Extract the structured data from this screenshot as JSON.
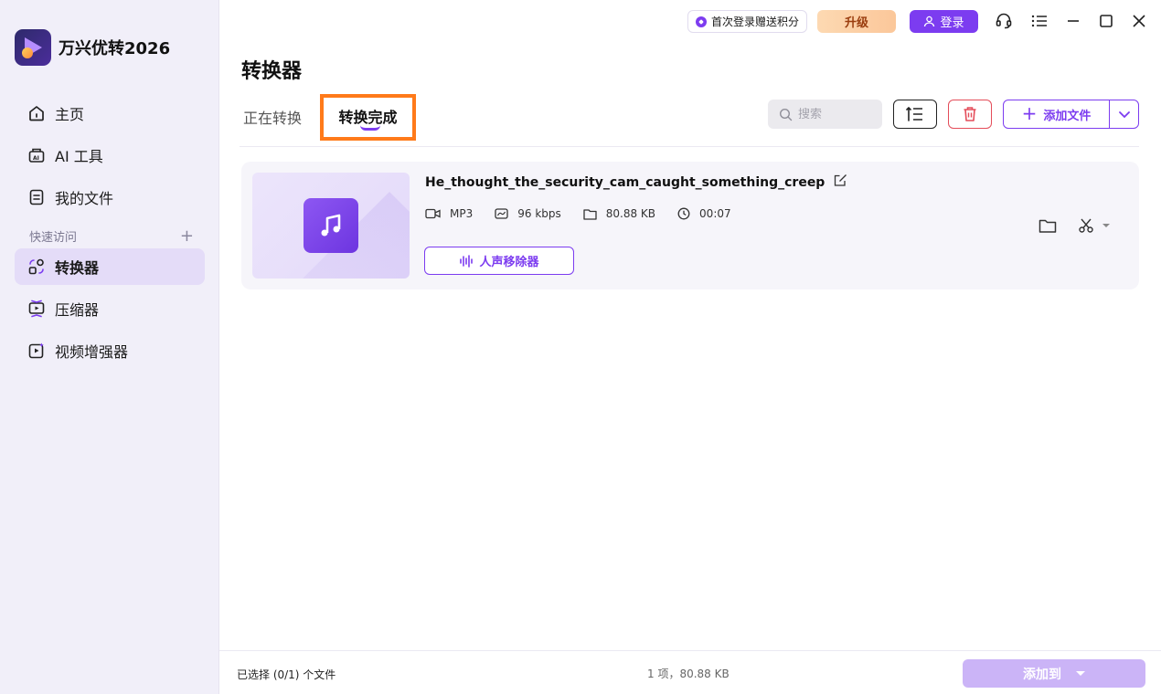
{
  "app": {
    "name": "万兴优转2026"
  },
  "sidebar": {
    "items": [
      {
        "label": "主页",
        "icon": "home-icon"
      },
      {
        "label": "AI 工具",
        "icon": "ai-tools-icon"
      },
      {
        "label": "我的文件",
        "icon": "my-files-icon"
      }
    ],
    "quick_access_label": "快速访问",
    "quick_items": [
      {
        "label": "转换器",
        "icon": "converter-icon",
        "active": true
      },
      {
        "label": "压缩器",
        "icon": "compressor-icon"
      },
      {
        "label": "视频增强器",
        "icon": "video-enhancer-icon"
      }
    ]
  },
  "topbar": {
    "promo_label": "首次登录赠送积分",
    "upgrade_label": "升级",
    "login_label": "登录"
  },
  "main": {
    "title": "转换器",
    "tabs": [
      {
        "label": "正在转换"
      },
      {
        "label": "转换完成",
        "active": true
      }
    ],
    "search": {
      "placeholder": "搜索"
    },
    "add_file_label": "添加文件"
  },
  "files": [
    {
      "name": "He_thought_the_security_cam_caught_something_creep",
      "format": "MP3",
      "bitrate": "96 kbps",
      "size": "80.88 KB",
      "duration": "00:07",
      "vocal_remover_label": "人声移除器"
    }
  ],
  "footer": {
    "selected_text": "已选择 (0/1) 个文件",
    "summary_text": "1 项，80.88 KB",
    "add_to_label": "添加到"
  },
  "colors": {
    "accent": "#7c3cf0",
    "highlight_box": "#ff7a1a",
    "danger": "#e44d5a"
  }
}
